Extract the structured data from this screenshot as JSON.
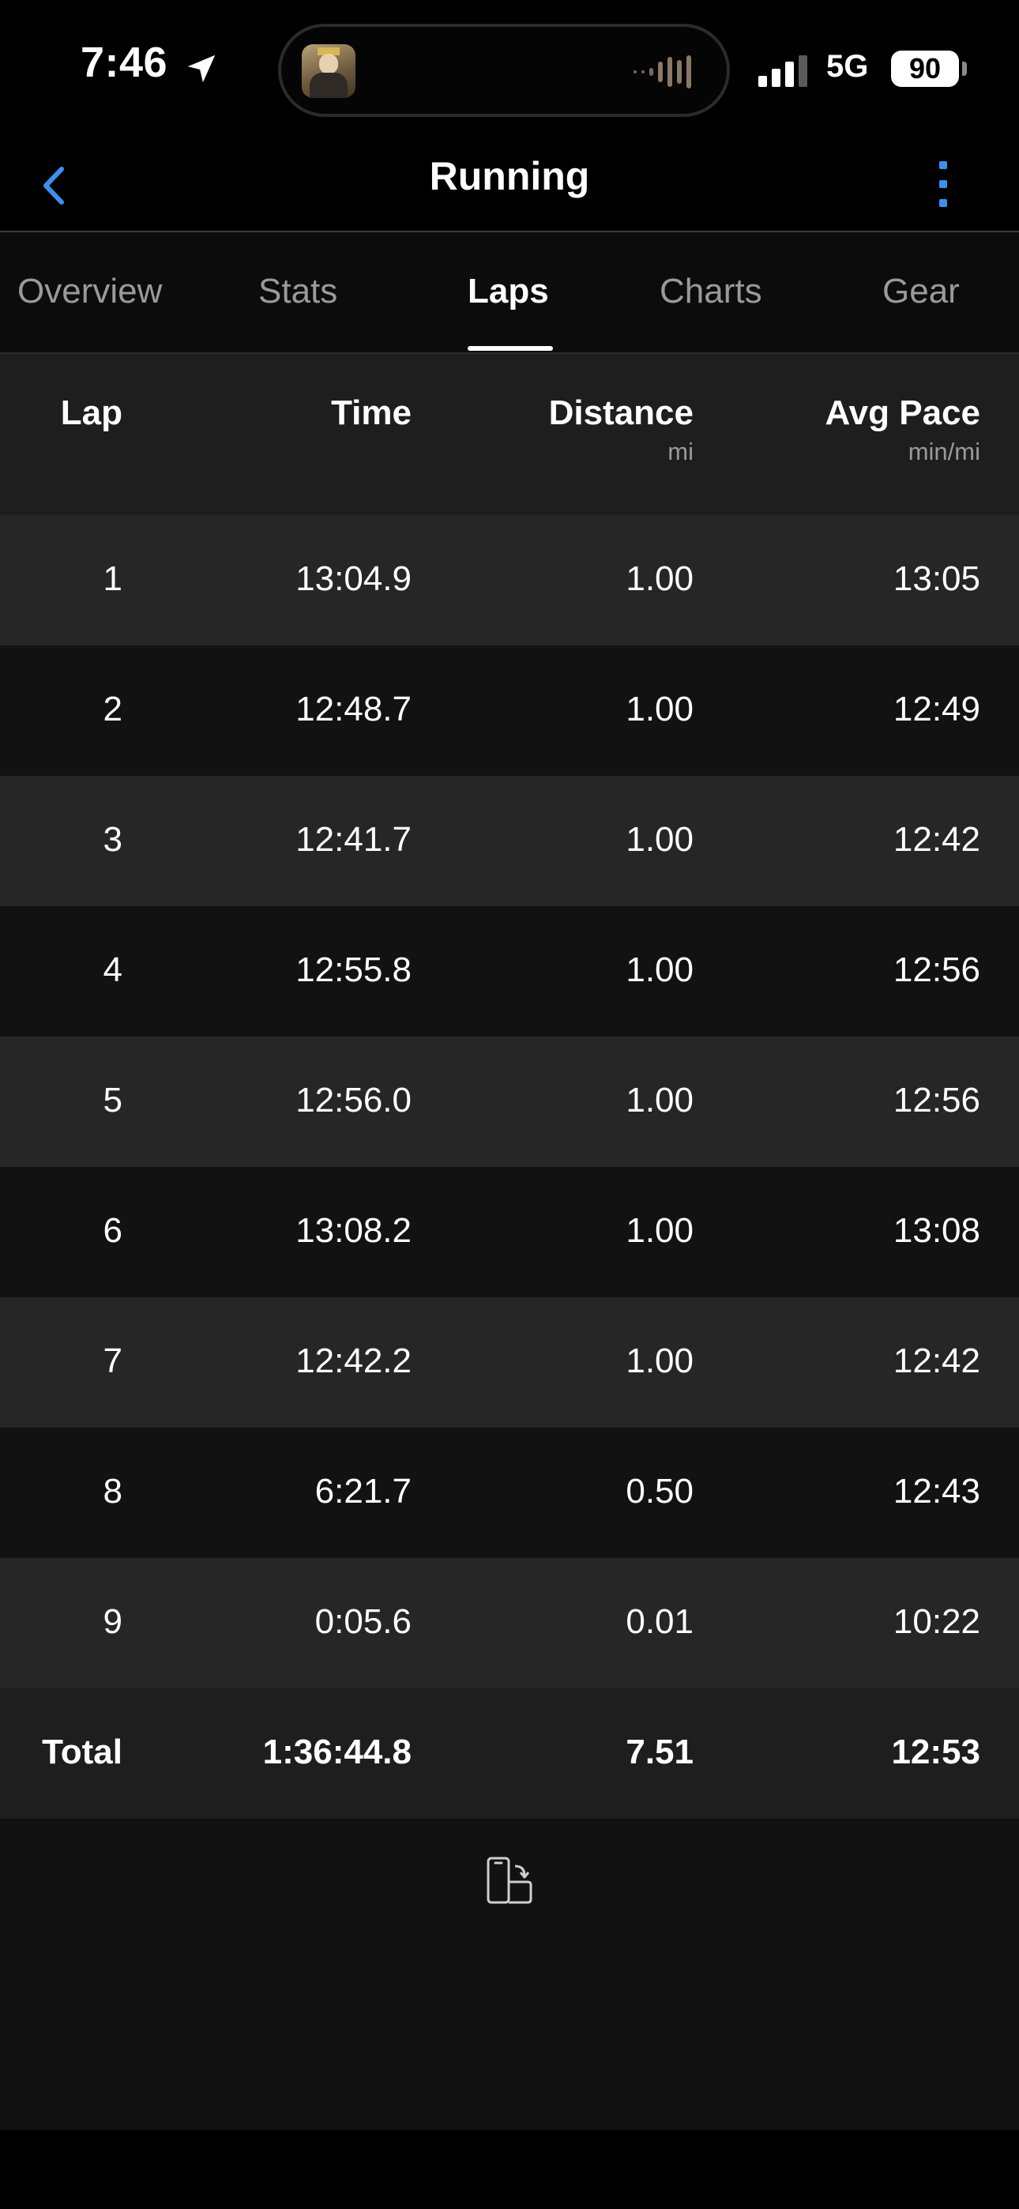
{
  "status_bar": {
    "time": "7:46",
    "network": "5G",
    "battery": "90",
    "icons": [
      "location-arrow-icon",
      "now-playing-avatar",
      "audio-wave-icon",
      "cell-signal-icon",
      "battery-icon"
    ]
  },
  "nav": {
    "title": "Running",
    "back_icon": "chevron-left-icon",
    "more_icon": "vertical-ellipsis-icon",
    "accent_color": "#3d8fef"
  },
  "tabs": [
    {
      "label": "Overview",
      "active": false
    },
    {
      "label": "Stats",
      "active": false
    },
    {
      "label": "Laps",
      "active": true
    },
    {
      "label": "Charts",
      "active": false
    },
    {
      "label": "Gear",
      "active": false
    }
  ],
  "table": {
    "headers": {
      "lap": "Lap",
      "time": "Time",
      "distance": "Distance",
      "distance_unit": "mi",
      "pace": "Avg Pace",
      "pace_unit": "min/mi"
    },
    "rows": [
      {
        "lap": "1",
        "time": "13:04.9",
        "distance": "1.00",
        "pace": "13:05"
      },
      {
        "lap": "2",
        "time": "12:48.7",
        "distance": "1.00",
        "pace": "12:49"
      },
      {
        "lap": "3",
        "time": "12:41.7",
        "distance": "1.00",
        "pace": "12:42"
      },
      {
        "lap": "4",
        "time": "12:55.8",
        "distance": "1.00",
        "pace": "12:56"
      },
      {
        "lap": "5",
        "time": "12:56.0",
        "distance": "1.00",
        "pace": "12:56"
      },
      {
        "lap": "6",
        "time": "13:08.2",
        "distance": "1.00",
        "pace": "13:08"
      },
      {
        "lap": "7",
        "time": "12:42.2",
        "distance": "1.00",
        "pace": "12:42"
      },
      {
        "lap": "8",
        "time": "6:21.7",
        "distance": "0.50",
        "pace": "12:43"
      },
      {
        "lap": "9",
        "time": "0:05.6",
        "distance": "0.01",
        "pace": "10:22"
      }
    ],
    "total": {
      "lap": "Total",
      "time": "1:36:44.8",
      "distance": "7.51",
      "pace": "12:53"
    }
  },
  "footer": {
    "rotate_icon": "rotate-to-landscape-icon"
  }
}
